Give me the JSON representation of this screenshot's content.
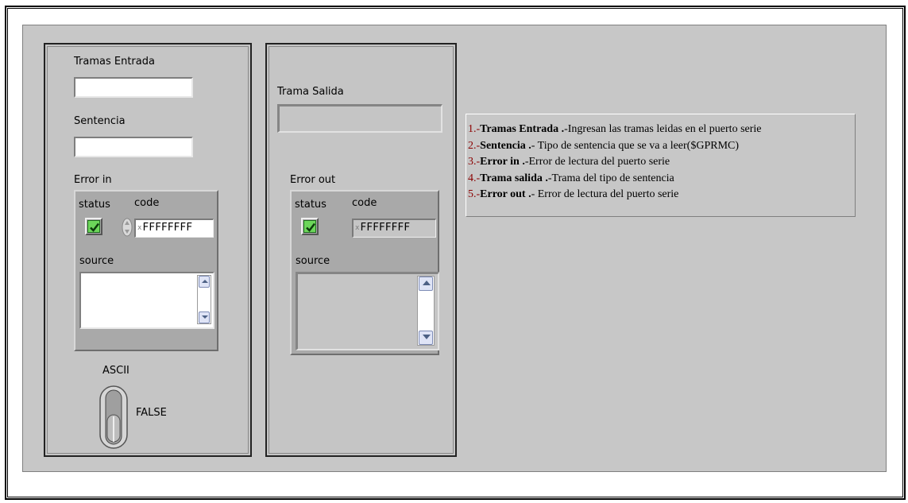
{
  "panel_left": {
    "tramas_entrada": {
      "label": "Tramas  Entrada",
      "value": ""
    },
    "sentencia": {
      "label": "Sentencia",
      "value": ""
    },
    "error_in": {
      "label": "Error in",
      "status_label": "status",
      "code_label": "code",
      "code_radix": "x",
      "code_value": "FFFFFFFF",
      "source_label": "source",
      "source_value": ""
    },
    "ascii": {
      "label": "ASCII",
      "state_text": "FALSE"
    }
  },
  "panel_right": {
    "trama_salida": {
      "label": "Trama Salida",
      "value": ""
    },
    "error_out": {
      "label": "Error out",
      "status_label": "status",
      "code_label": "code",
      "code_radix": "x",
      "code_value": "FFFFFFFF",
      "source_label": "source",
      "source_value": ""
    }
  },
  "description": {
    "lines": [
      {
        "num": "1.-",
        "bold": "Tramas Entrada .",
        "rest": "-Ingresan las tramas leidas en el puerto serie"
      },
      {
        "num": "2.-",
        "bold": "Sentencia .",
        "rest": "- Tipo de sentencia que se va a leer($GPRMC)"
      },
      {
        "num": "3.-",
        "bold": "Error in .",
        "rest": "-Error de lectura del puerto serie"
      },
      {
        "num": "4.-",
        "bold": "Trama salida .",
        "rest": "-Trama del tipo de sentencia"
      },
      {
        "num": "5.-",
        "bold": "Error out .",
        "rest": "- Error de lectura del puerto serie"
      }
    ]
  },
  "colors": {
    "panel_bg": "#c7c7c7",
    "led_on": "#6cd65a",
    "number_color": "#8b0000"
  }
}
